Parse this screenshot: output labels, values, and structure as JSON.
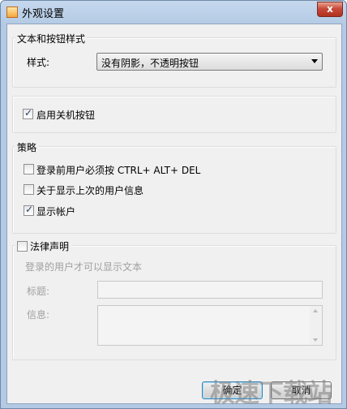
{
  "window": {
    "title": "外观设置",
    "close_glyph": "x"
  },
  "appearance": {
    "group_title": "文本和按钮样式",
    "style_label": "样式:",
    "style_value": "没有阴影，不透明按钮"
  },
  "shutdown": {
    "label": "启用关机按钮",
    "checked": true
  },
  "policy": {
    "group_title": "策略",
    "items": [
      {
        "label": "登录前用户必须按 CTRL+ ALT+ DEL",
        "checked": false
      },
      {
        "label": "关于显示上次的用户信息",
        "checked": false
      },
      {
        "label": "显示帐户",
        "checked": true
      }
    ]
  },
  "legal": {
    "label": "法律声明",
    "checked": false,
    "hint": "登录的用户才可以显示文本",
    "title_label": "标题:",
    "info_label": "信息:"
  },
  "buttons": {
    "ok": "确定",
    "cancel": "取消"
  },
  "watermark": "极速下载站"
}
